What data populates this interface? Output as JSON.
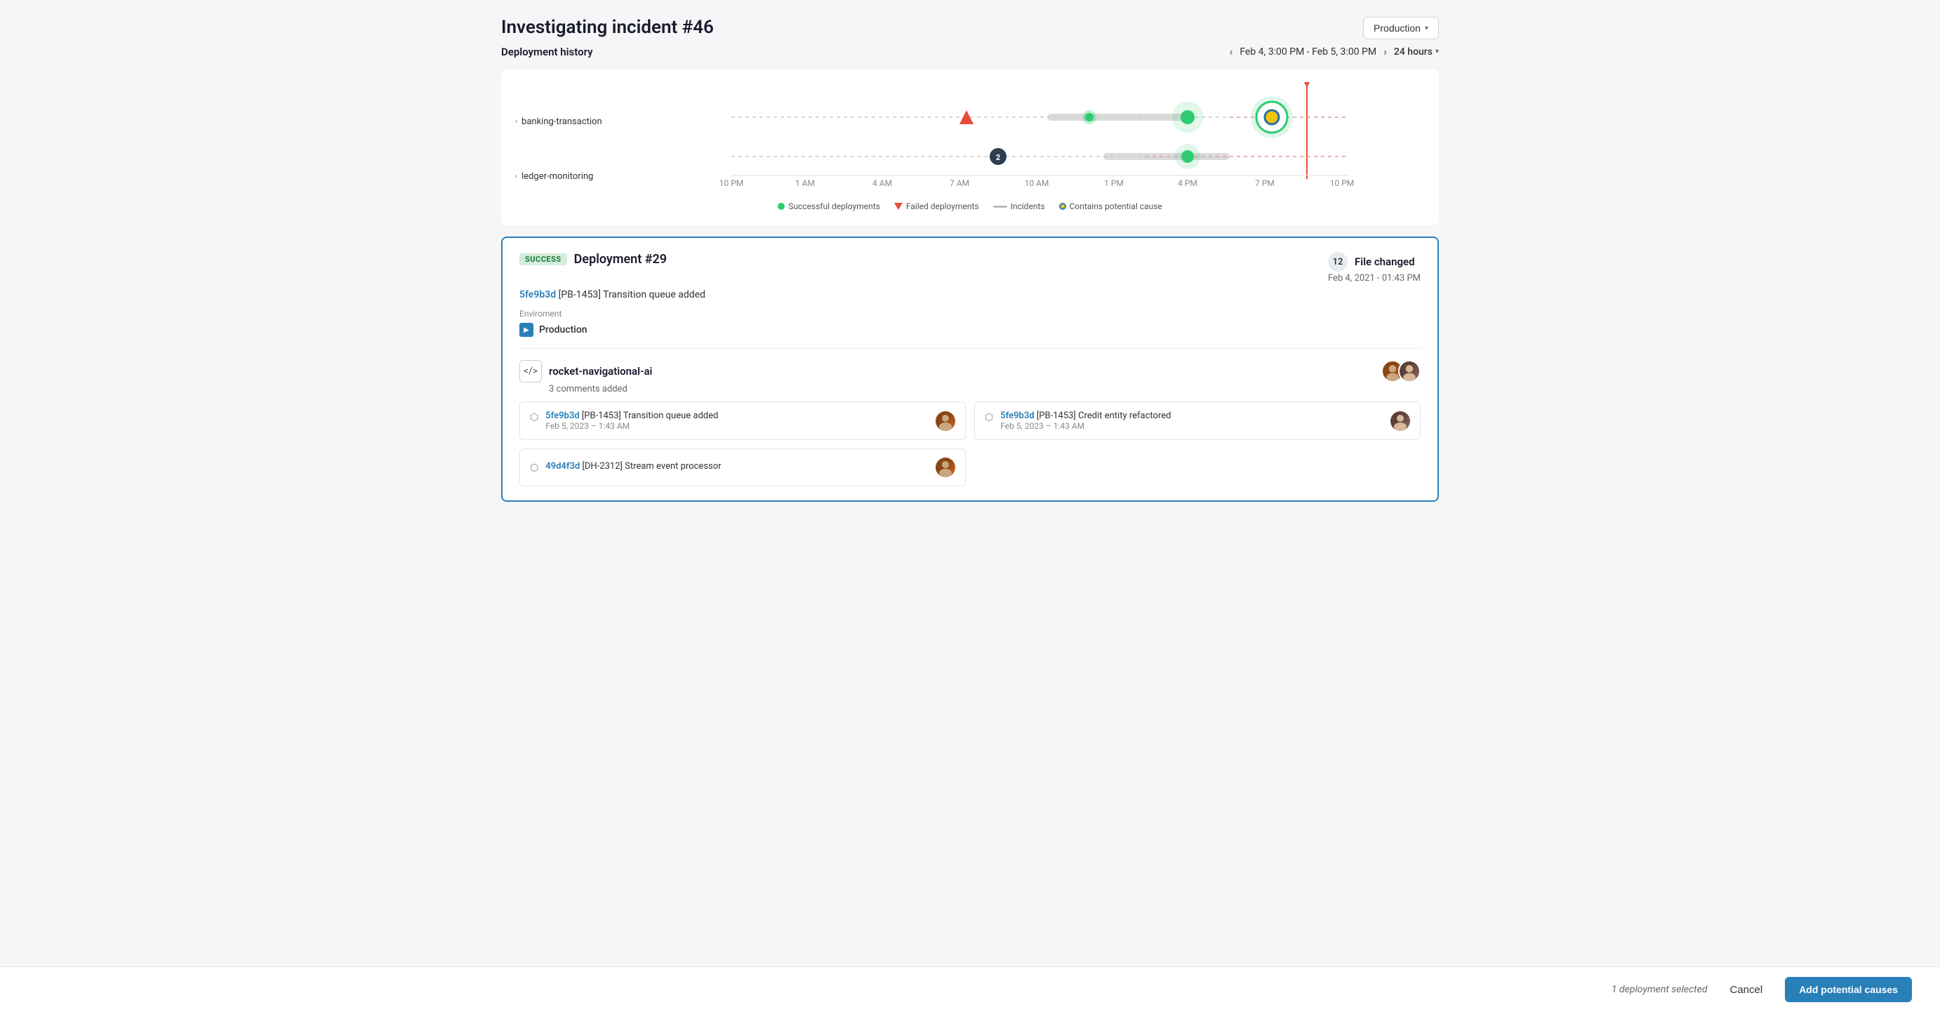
{
  "page": {
    "title": "Investigating incident #46"
  },
  "environment_dropdown": {
    "label": "Production",
    "chevron": "▾"
  },
  "deployment_history": {
    "title": "Deployment history",
    "date_range": "Feb 4, 3:00 PM - Feb 5, 3:00 PM",
    "time_selector": "24 hours",
    "chevron": "▾",
    "prev_arrow": "‹",
    "next_arrow": "›"
  },
  "chart": {
    "time_labels": [
      "10 PM",
      "1 AM",
      "4 AM",
      "7 AM",
      "10 AM",
      "1 PM",
      "4 PM",
      "7 PM",
      "10 PM"
    ],
    "services": [
      {
        "name": "banking-transaction"
      },
      {
        "name": "ledger-monitoring"
      }
    ],
    "legend": {
      "successful": "Successful deployments",
      "failed": "Failed deployments",
      "incidents": "Incidents",
      "potential": "Contains potential cause"
    }
  },
  "deployment_card": {
    "status_badge": "SUCCESS",
    "title": "Deployment #29",
    "commit_line": "5fe9b3d [PB-1453] Transition queue added",
    "commit_hash": "5fe9b3d",
    "commit_ticket": "[PB-1453]",
    "commit_message": "Transition queue added",
    "environment_label": "Enviroment",
    "environment_value": "Production",
    "file_count": "12",
    "file_changed_label": "File changed",
    "file_changed_date": "Feb 4, 2021 - 01:43 PM",
    "repo_name": "rocket-navigational-ai",
    "comments": "3 comments added",
    "commits": [
      {
        "hash": "5fe9b3d",
        "ticket": "[PB-1453]",
        "message": "Transition queue added",
        "date": "Feb 5, 2023 – 1:43 AM"
      },
      {
        "hash": "5fe9b3d",
        "ticket": "[PB-1453]",
        "message": "Credit entity refactored",
        "date": "Feb 5, 2023 – 1:43 AM"
      },
      {
        "hash": "49d4f3d",
        "ticket": "[DH-2312]",
        "message": "Stream event processor",
        "date": ""
      }
    ]
  },
  "bottom_bar": {
    "selected_text": "1 deployment selected",
    "cancel_label": "Cancel",
    "add_label": "Add potential causes"
  }
}
